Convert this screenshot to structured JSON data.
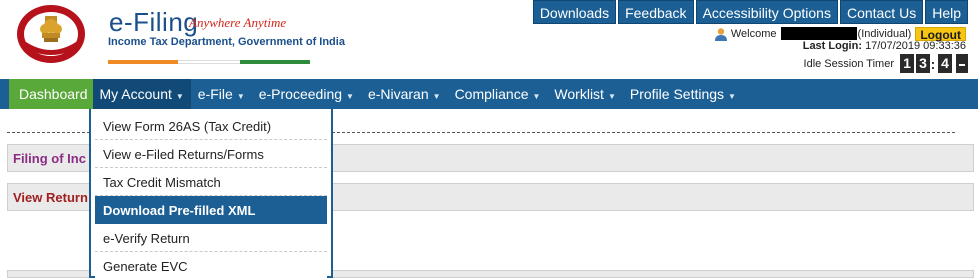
{
  "brand": {
    "title": "e-Filing",
    "tagline": "Anywhere Anytime",
    "department": "Income Tax Department, Government of India",
    "logo_text": "INCOME TAX DEPARTMENT",
    "bar_colors": [
      "#f08a24",
      "#ffffff",
      "#2e8b3a"
    ]
  },
  "top_links": [
    "Downloads",
    "Feedback",
    "Accessibility Options",
    "Contact Us",
    "Help"
  ],
  "user": {
    "welcome_label": "Welcome",
    "role": "(Individual)",
    "logout_label": "Logout",
    "last_login_label": "Last Login:",
    "last_login_value": "17/07/2019 09:33:36",
    "idle_label": "Idle Session Timer",
    "timer_digits": [
      "1",
      "3",
      "4"
    ]
  },
  "nav": [
    {
      "label": "Dashboard",
      "caret": ""
    },
    {
      "label": "My Account",
      "caret": "▼"
    },
    {
      "label": "e-File",
      "caret": "▼"
    },
    {
      "label": "e-Proceeding",
      "caret": "▼"
    },
    {
      "label": "e-Nivaran",
      "caret": "▼"
    },
    {
      "label": "Compliance",
      "caret": "▼"
    },
    {
      "label": "Worklist",
      "caret": "▼"
    },
    {
      "label": "Profile Settings",
      "caret": "▼"
    }
  ],
  "dropdown": {
    "items": [
      "View Form 26AS (Tax Credit)",
      "View e-Filed Returns/Forms",
      "Tax Credit Mismatch",
      "Download Pre-filled XML",
      "e-Verify Return",
      "Generate EVC"
    ],
    "highlighted": "Download Pre-filled XML"
  },
  "sections": {
    "filing": "Filing of Inc",
    "view_returns": "View Return"
  },
  "colors": {
    "primary": "#1b5f95",
    "home": "#58a83a",
    "logout": "#f7c512"
  }
}
